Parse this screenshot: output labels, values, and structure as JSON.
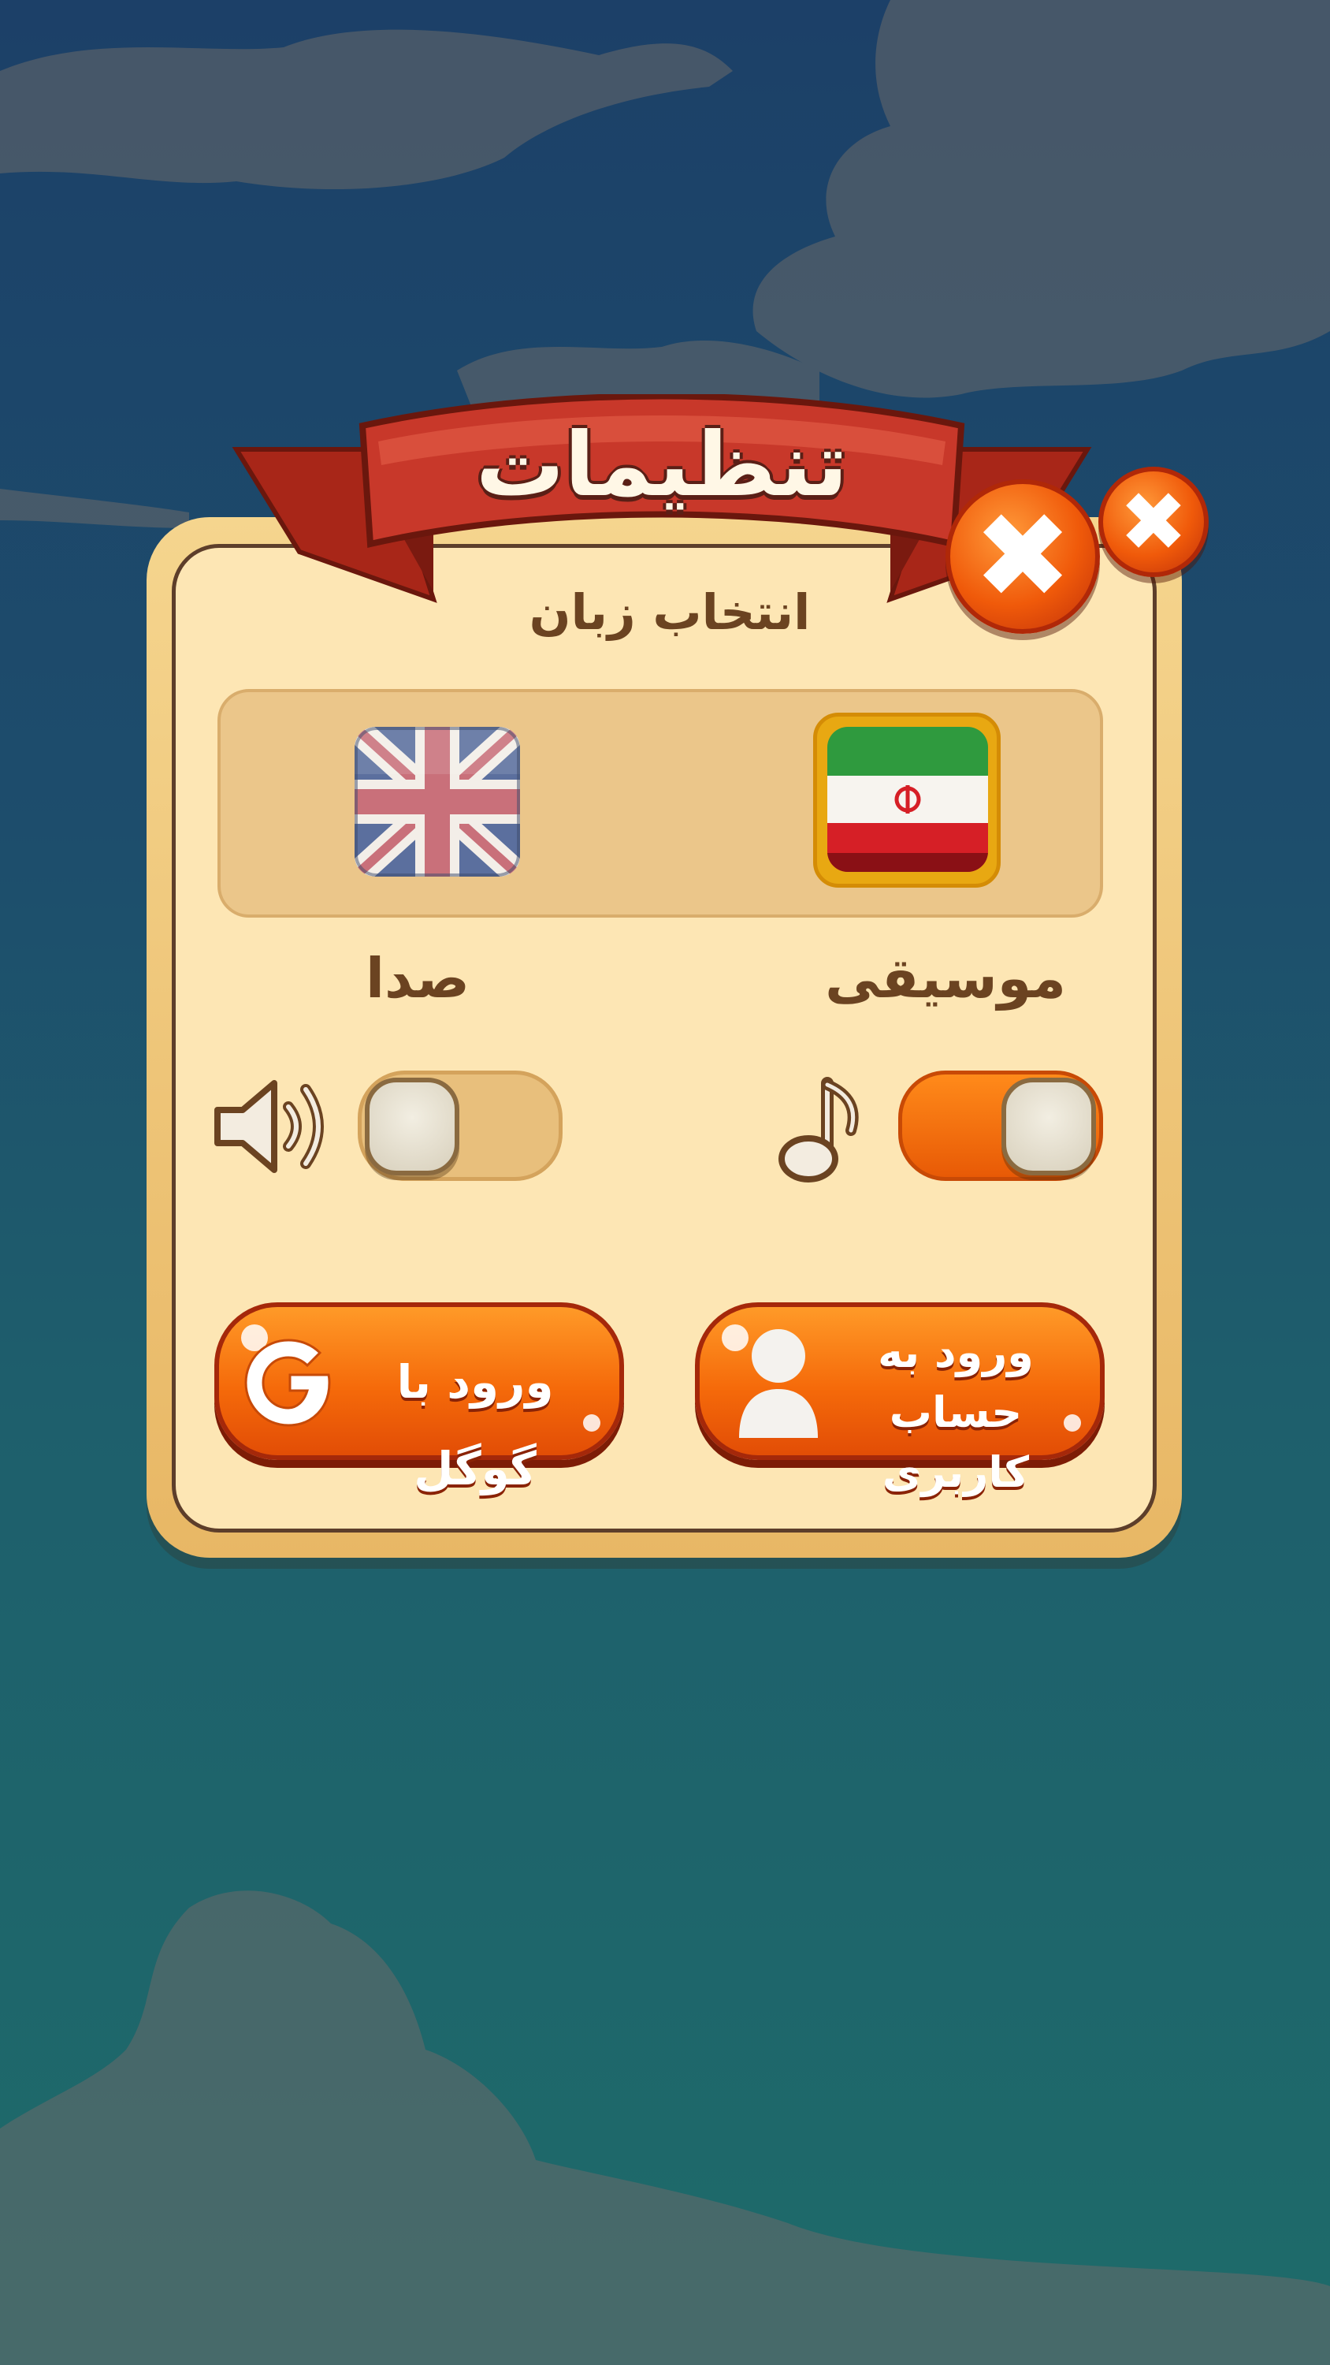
{
  "dialog": {
    "title": "تنظیمات",
    "close_glyph": "✖",
    "language_label": "انتخاب زبان",
    "languages": [
      {
        "code": "en",
        "icon": "uk-flag-icon",
        "selected": false
      },
      {
        "code": "fa",
        "icon": "iran-flag-icon",
        "selected": true
      }
    ],
    "sound": {
      "label": "صدا",
      "icon": "speaker-icon",
      "enabled": false
    },
    "music": {
      "label": "موسیقی",
      "icon": "music-note-icon",
      "enabled": true
    },
    "google_button": {
      "label": "ورود با گوگل",
      "icon": "google-icon"
    },
    "account_button": {
      "label_line1": "ورود به",
      "label_line2": "حساب کاربری",
      "icon": "user-icon"
    }
  },
  "colors": {
    "sky_top": "#1c4068",
    "sky_bottom": "#1e6b6a",
    "panel": "#fde6b4",
    "ribbon": "#c8382a",
    "button_orange": "#f56a0a"
  }
}
